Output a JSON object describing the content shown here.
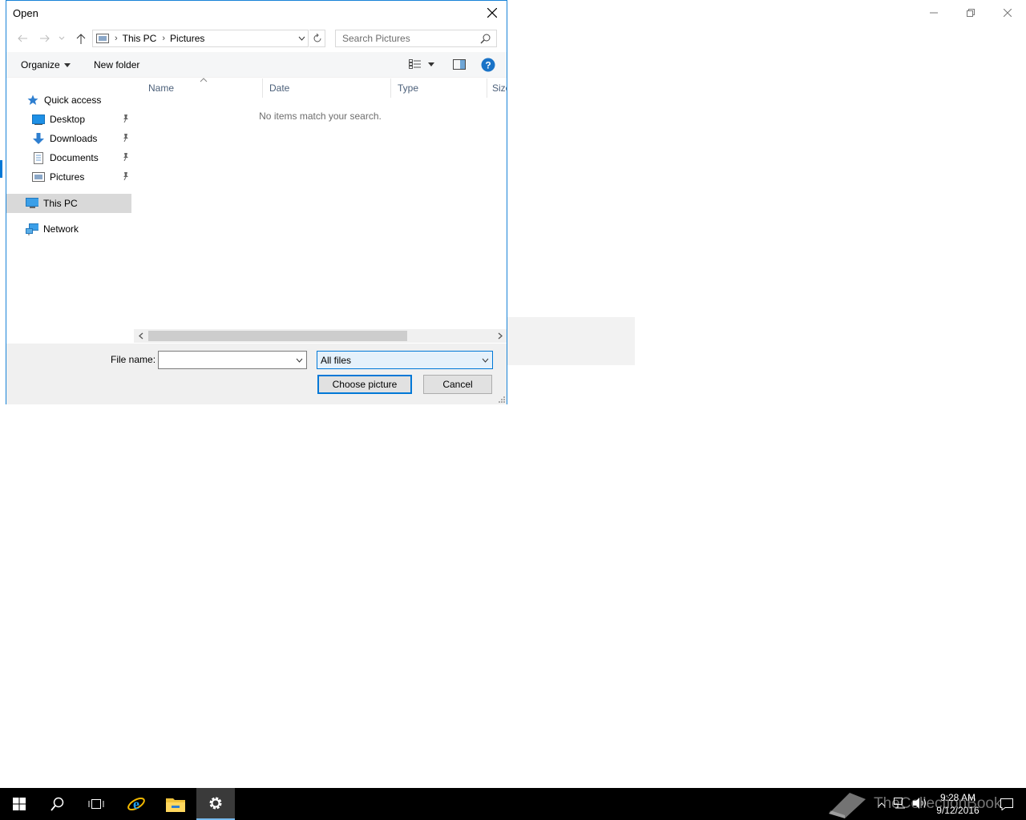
{
  "dialog": {
    "title": "Open",
    "address": {
      "crumbs": [
        "This PC",
        "Pictures"
      ]
    },
    "search": {
      "placeholder": "Search Pictures"
    },
    "toolbar": {
      "organize": "Organize",
      "new_folder": "New folder"
    },
    "nav": {
      "quick_access": "Quick access",
      "items": [
        {
          "label": "Desktop",
          "icon": "desktop-icon",
          "pinned": true
        },
        {
          "label": "Downloads",
          "icon": "downloads-icon",
          "pinned": true
        },
        {
          "label": "Documents",
          "icon": "documents-icon",
          "pinned": true
        },
        {
          "label": "Pictures",
          "icon": "pictures-icon",
          "pinned": true
        }
      ],
      "this_pc": "This PC",
      "network": "Network"
    },
    "columns": [
      "Name",
      "Date",
      "Type",
      "Size"
    ],
    "empty_message": "No items match your search.",
    "file_name": {
      "label": "File name:",
      "value": ""
    },
    "file_type": {
      "selected": "All files"
    },
    "buttons": {
      "ok": "Choose picture",
      "cancel": "Cancel"
    }
  },
  "taskbar": {
    "clock": {
      "time": "9:28 AM",
      "date": "9/12/2016"
    },
    "watermark": "TheCollectionBook"
  },
  "colors": {
    "accent": "#0078d7",
    "taskbar": "#000000",
    "selected_nav": "#d9d9d9"
  }
}
